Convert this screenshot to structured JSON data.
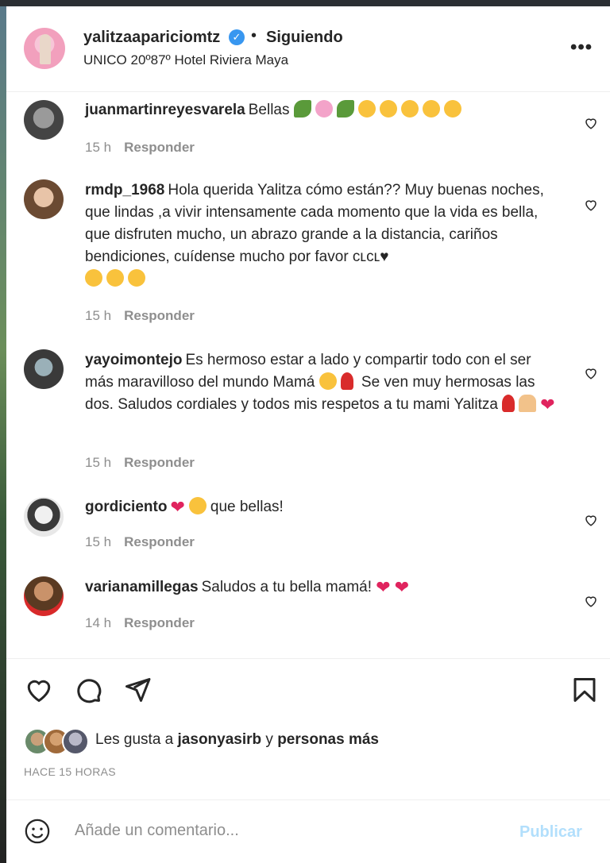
{
  "post": {
    "username": "yalitzaaparicio mtz",
    "username_text": "yalitzaapariciomtz",
    "separator": "•",
    "follow_state": "Siguiendo",
    "location": "UNICO 20º87º Hotel Riviera Maya",
    "more_icon": "more-options-icon"
  },
  "comments": [
    {
      "user": "juanmartinreyesvarela",
      "text": "Bellas",
      "emojis": [
        "leaf",
        "flower",
        "leaf",
        "yellow",
        "yellow",
        "yellow",
        "yellow",
        "yellow"
      ],
      "time": "15 h",
      "reply": "Responder"
    },
    {
      "user": "rmdp_1968",
      "text": "Hola querida Yalitza cómo están?? Muy buenas noches, que lindas ,a vivir intensamente cada momento que la vida es bella, que disfruten mucho, un abrazo grande a la distancia, cariños bendiciones, cuídense mucho por favor ᴄʟᴄʟ♥",
      "emojis": [
        "yellow",
        "yellow",
        "yellow"
      ],
      "time": "15 h",
      "reply": "Responder"
    },
    {
      "user": "yayoimontejo",
      "text": "Es hermoso estar a lado y compartir todo con el ser más maravilloso del mundo Mamá",
      "text2": "Se ven muy hermosas las dos. Saludos cordiales y todos mis respetos a tu mami Yalitza",
      "time": "15 h",
      "reply": "Responder"
    },
    {
      "user": "gordiciento",
      "text": "que bellas!",
      "time": "15 h",
      "reply": "Responder"
    },
    {
      "user": "varianamillegas",
      "text": "Saludos a tu bella mamá!",
      "time": "14 h",
      "reply": "Responder"
    }
  ],
  "likes": {
    "prefix": "Les gusta a",
    "user": "jasonyasirb",
    "conj": "y",
    "rest": "personas más"
  },
  "timestamp": "HACE 15 HORAS",
  "composer": {
    "placeholder": "Añade un comentario...",
    "publish": "Publicar"
  },
  "colors": {
    "verified": "#3897f0",
    "publish_disabled": "#b2dffc",
    "meta_gray": "#8e8e8e",
    "heart_red": "#e0245e"
  }
}
